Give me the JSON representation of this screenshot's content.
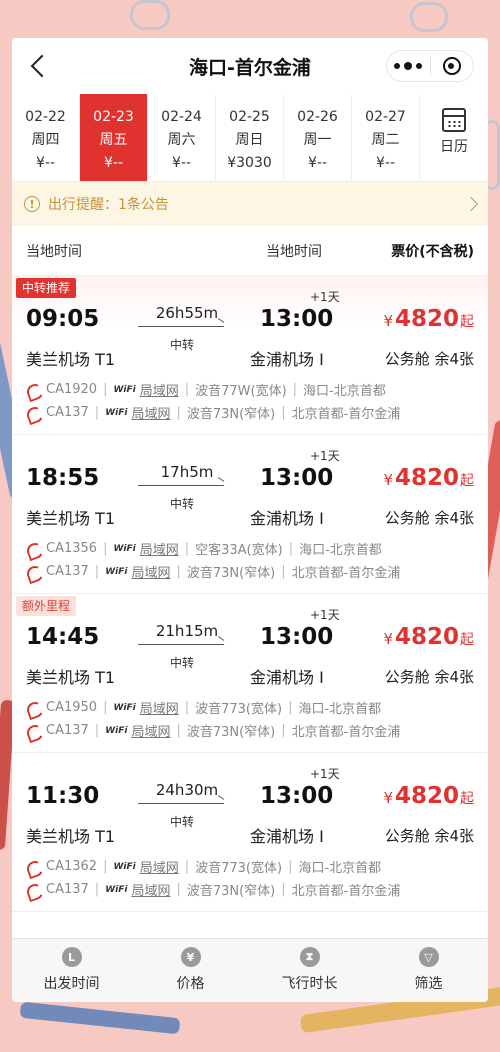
{
  "header": {
    "title": "海口-首尔金浦"
  },
  "dates": [
    {
      "date": "02-22",
      "weekday": "周四",
      "price": "¥--"
    },
    {
      "date": "02-23",
      "weekday": "周五",
      "price": "¥--"
    },
    {
      "date": "02-24",
      "weekday": "周六",
      "price": "¥--"
    },
    {
      "date": "02-25",
      "weekday": "周日",
      "price": "¥3030"
    },
    {
      "date": "02-26",
      "weekday": "周一",
      "price": "¥--"
    },
    {
      "date": "02-27",
      "weekday": "周二",
      "price": "¥--"
    }
  ],
  "calendar_label": "日历",
  "notice": {
    "text": "出行提醒：1条公告"
  },
  "columns": {
    "dep": "当地时间",
    "arr": "当地时间",
    "price": "票价(不含税)"
  },
  "flights": [
    {
      "tag": "中转推荐",
      "dep_time": "09:05",
      "arr_time": "13:00",
      "plus_day": "+1天",
      "duration": "26h55m",
      "transfer": "中转",
      "dep_airport": "美兰机场 T1",
      "arr_airport": "金浦机场 I",
      "currency": "¥",
      "price": "4820",
      "price_suffix": "起",
      "cabin": "公务舱 余4张",
      "segments": [
        {
          "flight_no": "CA1920",
          "wifi": "WiFi",
          "network": "局域网",
          "aircraft": "波音77W(宽体)",
          "route": "海口-北京首都"
        },
        {
          "flight_no": "CA137",
          "wifi": "WiFi",
          "network": "局域网",
          "aircraft": "波音73N(窄体)",
          "route": "北京首都-首尔金浦"
        }
      ]
    },
    {
      "tag": "",
      "dep_time": "18:55",
      "arr_time": "13:00",
      "plus_day": "+1天",
      "duration": "17h5m",
      "transfer": "中转",
      "dep_airport": "美兰机场 T1",
      "arr_airport": "金浦机场 I",
      "currency": "¥",
      "price": "4820",
      "price_suffix": "起",
      "cabin": "公务舱 余4张",
      "segments": [
        {
          "flight_no": "CA1356",
          "wifi": "WiFi",
          "network": "局域网",
          "aircraft": "空客33A(宽体)",
          "route": "海口-北京首都"
        },
        {
          "flight_no": "CA137",
          "wifi": "WiFi",
          "network": "局域网",
          "aircraft": "波音73N(窄体)",
          "route": "北京首都-首尔金浦"
        }
      ]
    },
    {
      "tag": "额外里程",
      "dep_time": "14:45",
      "arr_time": "13:00",
      "plus_day": "+1天",
      "duration": "21h15m",
      "transfer": "中转",
      "dep_airport": "美兰机场 T1",
      "arr_airport": "金浦机场 I",
      "currency": "¥",
      "price": "4820",
      "price_suffix": "起",
      "cabin": "公务舱 余4张",
      "segments": [
        {
          "flight_no": "CA1950",
          "wifi": "WiFi",
          "network": "局域网",
          "aircraft": "波音773(宽体)",
          "route": "海口-北京首都"
        },
        {
          "flight_no": "CA137",
          "wifi": "WiFi",
          "network": "局域网",
          "aircraft": "波音73N(窄体)",
          "route": "北京首都-首尔金浦"
        }
      ]
    },
    {
      "tag": "",
      "dep_time": "11:30",
      "arr_time": "13:00",
      "plus_day": "+1天",
      "duration": "24h30m",
      "transfer": "中转",
      "dep_airport": "美兰机场 T1",
      "arr_airport": "金浦机场 I",
      "currency": "¥",
      "price": "4820",
      "price_suffix": "起",
      "cabin": "公务舱 余4张",
      "segments": [
        {
          "flight_no": "CA1362",
          "wifi": "WiFi",
          "network": "局域网",
          "aircraft": "波音773(宽体)",
          "route": "海口-北京首都"
        },
        {
          "flight_no": "CA137",
          "wifi": "WiFi",
          "network": "局域网",
          "aircraft": "波音73N(窄体)",
          "route": "北京首都-首尔金浦"
        }
      ]
    }
  ],
  "tabbar": [
    {
      "label": "出发时间",
      "icon": "clock-icon",
      "glyph": "L"
    },
    {
      "label": "价格",
      "icon": "yen-icon",
      "glyph": "¥"
    },
    {
      "label": "飞行时长",
      "icon": "hourglass-icon",
      "glyph": "⧗"
    },
    {
      "label": "筛选",
      "icon": "filter-icon",
      "glyph": "▽"
    }
  ],
  "colors": {
    "accent": "#e0322f",
    "notice_text": "#c8933c",
    "notice_bg": "#fdf6e4"
  }
}
